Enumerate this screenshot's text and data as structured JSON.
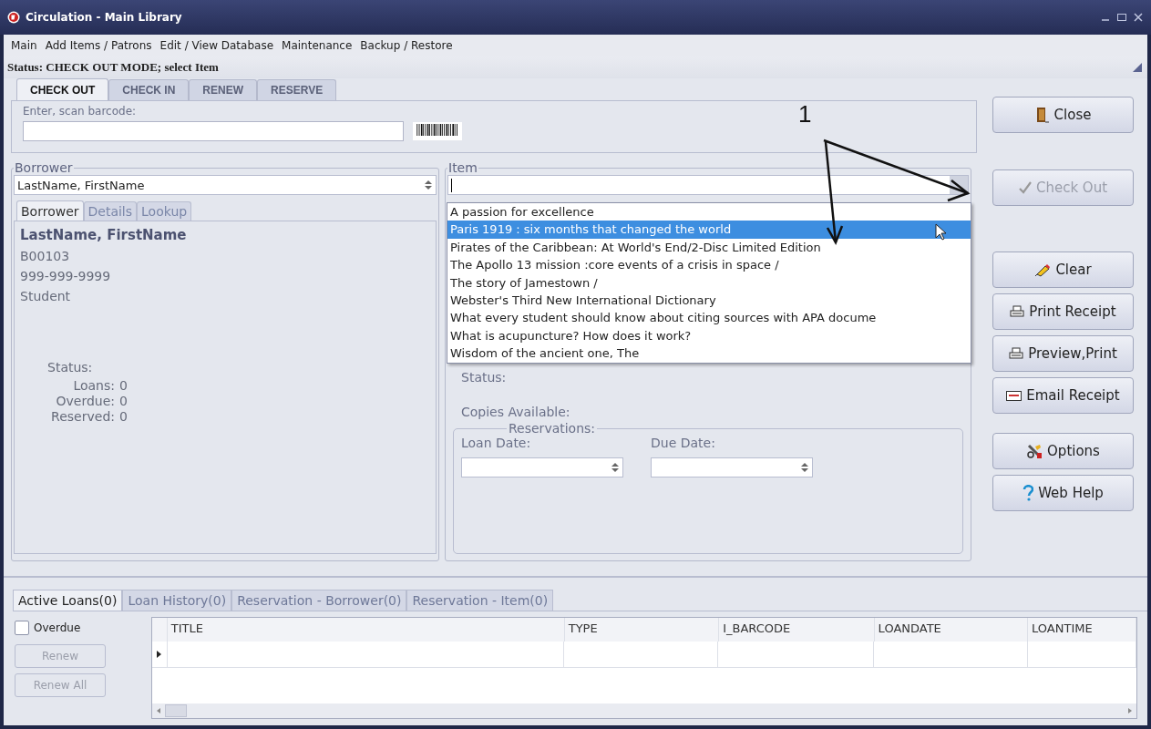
{
  "window": {
    "title": "Circulation - Main Library"
  },
  "menu": [
    "Main",
    "Add Items / Patrons",
    "Edit / View Database",
    "Maintenance",
    "Backup / Restore"
  ],
  "status": "Status: CHECK OUT MODE; select Item",
  "mode_tabs": [
    {
      "label": "CHECK OUT",
      "selected": true
    },
    {
      "label": "CHECK IN",
      "selected": false
    },
    {
      "label": "RENEW",
      "selected": false
    },
    {
      "label": "RESERVE",
      "selected": false
    }
  ],
  "barcode": {
    "label": "Enter, scan barcode:"
  },
  "borrower": {
    "legend": "Borrower",
    "combo_value": "LastName, FirstName",
    "tabs": [
      {
        "label": "Borrower",
        "selected": true
      },
      {
        "label": "Details",
        "selected": false
      },
      {
        "label": "Lookup",
        "selected": false
      }
    ],
    "name": "LastName, FirstName",
    "lines": [
      "B00103",
      "999-999-9999",
      "Student"
    ],
    "status_label": "Status:",
    "counts": [
      {
        "label": "Loans:",
        "value": "0"
      },
      {
        "label": "Overdue:",
        "value": "0"
      },
      {
        "label": "Reserved:",
        "value": "0"
      }
    ]
  },
  "item": {
    "legend": "Item",
    "dropdown": [
      {
        "text": "A passion for excellence",
        "selected": false
      },
      {
        "text": "Paris 1919 : six months that changed the world",
        "selected": true
      },
      {
        "text": "Pirates of the Caribbean: At World's End/2-Disc Limited Edition",
        "selected": false
      },
      {
        "text": "The Apollo 13 mission :core events of a crisis in space /",
        "selected": false
      },
      {
        "text": "The story of Jamestown /",
        "selected": false
      },
      {
        "text": "Webster's Third New International Dictionary",
        "selected": false
      },
      {
        "text": "What every student should know about citing sources with APA docume",
        "selected": false
      },
      {
        "text": "What is acupuncture? How does it work?",
        "selected": false
      },
      {
        "text": "Wisdom of the ancient one, The",
        "selected": false
      }
    ],
    "status_label": "Status:",
    "copies_label": "Copies Available:",
    "reservations": {
      "legend": "Reservations:",
      "loan_date_label": "Loan Date:",
      "due_date_label": "Due Date:"
    }
  },
  "button_groups": [
    [
      {
        "label": "Close",
        "kind": "door",
        "disabled": false
      }
    ],
    [
      {
        "label": "Check Out",
        "kind": "check",
        "disabled": true
      }
    ],
    [
      {
        "label": "Clear",
        "kind": "eraser",
        "disabled": false
      },
      {
        "label": "Print Receipt",
        "kind": "printer",
        "disabled": false
      },
      {
        "label": "Preview,Print",
        "kind": "printer",
        "disabled": false
      },
      {
        "label": "Email Receipt",
        "kind": "envelope",
        "disabled": false
      }
    ],
    [
      {
        "label": "Options",
        "kind": "tools",
        "disabled": false
      },
      {
        "label": "Web Help",
        "kind": "help",
        "disabled": false
      }
    ]
  ],
  "annotation": {
    "label": "1"
  },
  "bottom_tabs": [
    {
      "label": "Active Loans(0)",
      "selected": true
    },
    {
      "label": "Loan History(0)",
      "selected": false
    },
    {
      "label": "Reservation - Borrower(0)",
      "selected": false
    },
    {
      "label": "Reservation - Item(0)",
      "selected": false
    }
  ],
  "overdue": {
    "label": "Overdue",
    "checked": false
  },
  "side_buttons": [
    {
      "label": "Renew",
      "disabled": true
    },
    {
      "label": "Renew All",
      "disabled": true
    }
  ],
  "table": {
    "columns": [
      "TITLE",
      "TYPE",
      "I_BARCODE",
      "LOANDATE",
      "LOANTIME"
    ]
  }
}
